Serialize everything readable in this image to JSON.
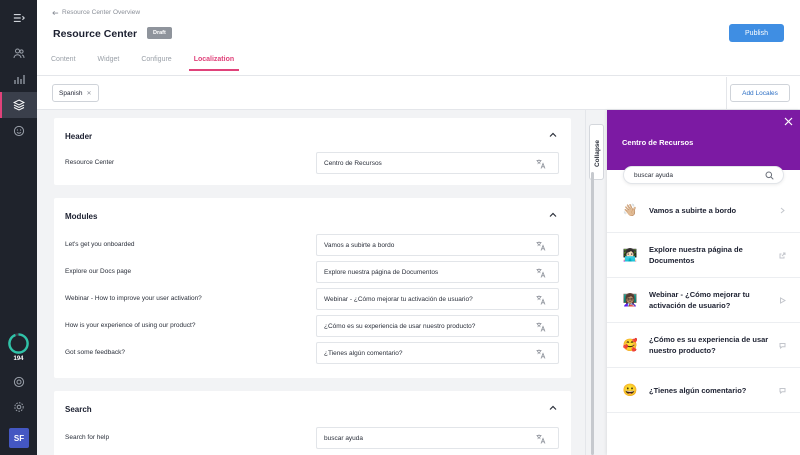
{
  "nav": {
    "progress_count": "194",
    "avatar_initials": "SF",
    "accent_color": "#e0427a"
  },
  "header": {
    "breadcrumb": "Resource Center Overview",
    "title": "Resource Center",
    "status_badge": "Draft",
    "publish_label": "Publish",
    "tabs": [
      {
        "label": "Content"
      },
      {
        "label": "Widget"
      },
      {
        "label": "Configure"
      },
      {
        "label": "Localization"
      }
    ]
  },
  "toolbar": {
    "language_chip": "Spanish",
    "add_locales_label": "Add Locales"
  },
  "sections": {
    "header": {
      "title": "Header",
      "rows": [
        {
          "label": "Resource Center",
          "value": "Centro de Recursos"
        }
      ]
    },
    "modules": {
      "title": "Modules",
      "rows": [
        {
          "label": "Let's get you onboarded",
          "value": "Vamos a subirte a bordo"
        },
        {
          "label": "Explore our Docs page",
          "value": "Explore nuestra página de Documentos"
        },
        {
          "label": "Webinar - How to improve your user activation?",
          "value": "Webinar - ¿Cómo mejorar tu activación de usuario?"
        },
        {
          "label": "How is your experience of using our product?",
          "value": "¿Cómo es su experiencia de usar nuestro producto?"
        },
        {
          "label": "Got some feedback?",
          "value": "¿Tienes algún comentario?"
        }
      ]
    },
    "search": {
      "title": "Search",
      "rows": [
        {
          "label": "Search for help",
          "value": "buscar ayuda"
        }
      ]
    }
  },
  "collapse_label": "Collapse",
  "preview": {
    "title": "Centro de Recursos",
    "header_color": "#7c1aa3",
    "search_value": "buscar ayuda",
    "items": [
      {
        "emoji": "👋🏼",
        "text": "Vamos a subirte a bordo",
        "icon": "chevron-right-icon"
      },
      {
        "emoji": "👩🏻‍💻",
        "text": "Explore nuestra página de Documentos",
        "icon": "external-link-icon"
      },
      {
        "emoji": "👩🏽‍🏫",
        "text": "Webinar - ¿Cómo mejorar tu activación de usuario?",
        "icon": "play-icon"
      },
      {
        "emoji": "🥰",
        "text": "¿Cómo es su experiencia de usar nuestro producto?",
        "icon": "chat-bubble-icon"
      },
      {
        "emoji": "😀",
        "text": "¿Tienes algún comentario?",
        "icon": "chat-bubble-icon"
      }
    ]
  }
}
